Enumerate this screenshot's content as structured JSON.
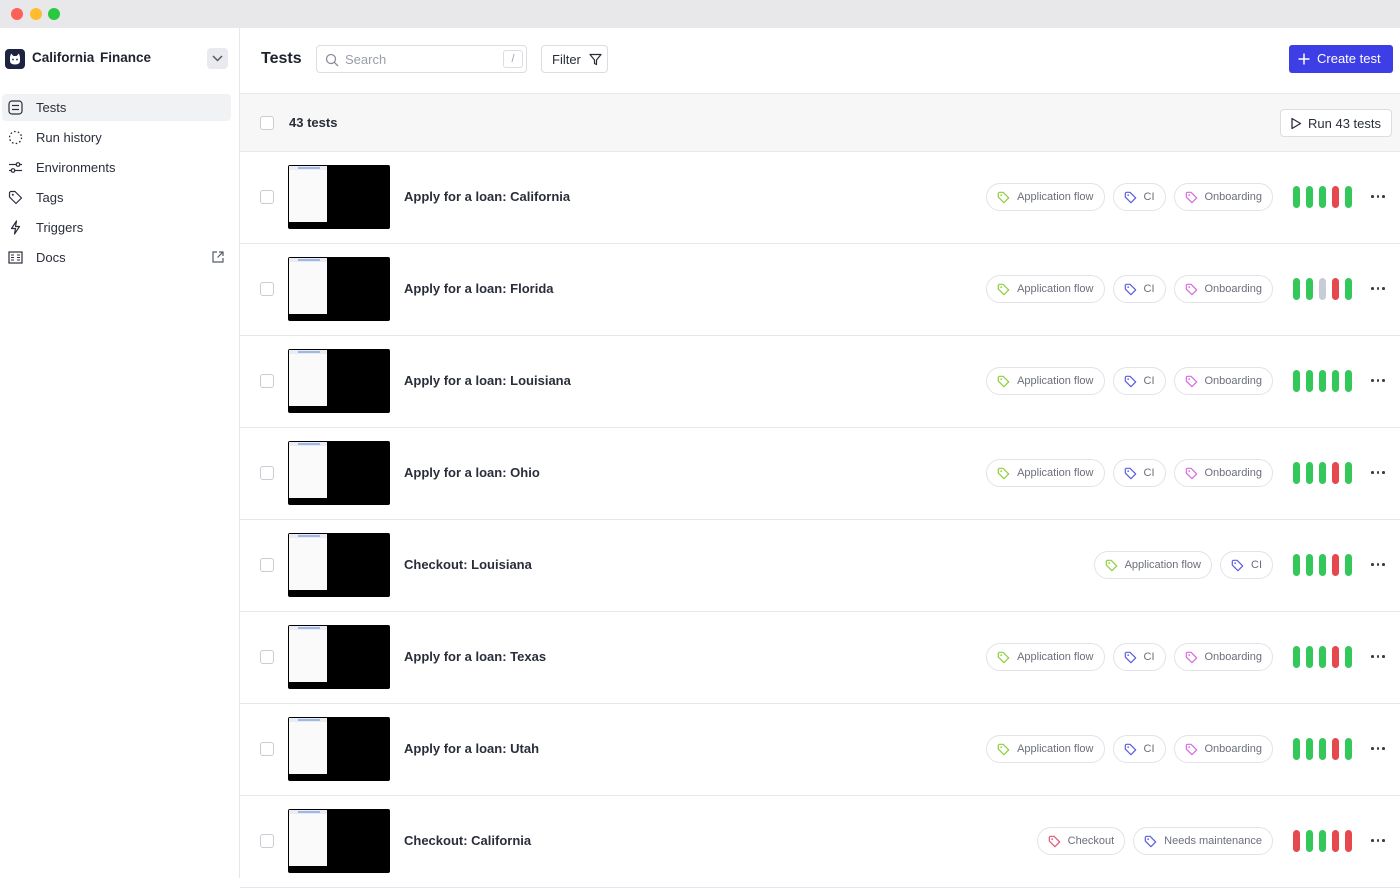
{
  "window": {},
  "sidebar": {
    "org_name": "California Finance",
    "items": [
      {
        "label": "Tests",
        "icon": "list-icon",
        "active": true
      },
      {
        "label": "Run history",
        "icon": "dashed-circle-icon",
        "active": false
      },
      {
        "label": "Environments",
        "icon": "sliders-icon",
        "active": false
      },
      {
        "label": "Tags",
        "icon": "tag-icon",
        "active": false
      },
      {
        "label": "Triggers",
        "icon": "lightning-icon",
        "active": false
      },
      {
        "label": "Docs",
        "icon": "book-icon",
        "active": false
      }
    ]
  },
  "header": {
    "title": "Tests",
    "search_placeholder": "Search",
    "search_shortcut": "/",
    "filter_label": "Filter",
    "create_label": "Create test"
  },
  "summary": {
    "count_label": "43 tests",
    "run_label": "Run 43 tests"
  },
  "colors": {
    "accent": "#3d3ee6",
    "pass": "#34c759",
    "fail": "#e5484d",
    "skipped": "#c8ccd6",
    "tag_application_flow": "#8fcf3c",
    "tag_ci": "#5b5fe0",
    "tag_onboarding": "#d86be0",
    "tag_checkout": "#e5567a",
    "tag_needs_maintenance": "#5b5fe0"
  },
  "tests": [
    {
      "name": "Apply for a loan: California",
      "tags": [
        {
          "label": "Application flow",
          "color": "#8fcf3c"
        },
        {
          "label": "CI",
          "color": "#5b5fe0"
        },
        {
          "label": "Onboarding",
          "color": "#d86be0"
        }
      ],
      "runs": [
        "pass",
        "pass",
        "pass",
        "fail",
        "pass"
      ]
    },
    {
      "name": "Apply for a loan: Florida",
      "tags": [
        {
          "label": "Application flow",
          "color": "#8fcf3c"
        },
        {
          "label": "CI",
          "color": "#5b5fe0"
        },
        {
          "label": "Onboarding",
          "color": "#d86be0"
        }
      ],
      "runs": [
        "pass",
        "pass",
        "skipped",
        "fail",
        "pass"
      ]
    },
    {
      "name": "Apply for a loan: Louisiana",
      "tags": [
        {
          "label": "Application flow",
          "color": "#8fcf3c"
        },
        {
          "label": "CI",
          "color": "#5b5fe0"
        },
        {
          "label": "Onboarding",
          "color": "#d86be0"
        }
      ],
      "runs": [
        "pass",
        "pass",
        "pass",
        "pass",
        "pass"
      ]
    },
    {
      "name": "Apply for a loan: Ohio",
      "tags": [
        {
          "label": "Application flow",
          "color": "#8fcf3c"
        },
        {
          "label": "CI",
          "color": "#5b5fe0"
        },
        {
          "label": "Onboarding",
          "color": "#d86be0"
        }
      ],
      "runs": [
        "pass",
        "pass",
        "pass",
        "fail",
        "pass"
      ]
    },
    {
      "name": "Checkout: Louisiana",
      "tags": [
        {
          "label": "Application flow",
          "color": "#8fcf3c"
        },
        {
          "label": "CI",
          "color": "#5b5fe0"
        }
      ],
      "runs": [
        "pass",
        "pass",
        "pass",
        "fail",
        "pass"
      ]
    },
    {
      "name": "Apply for a loan: Texas",
      "tags": [
        {
          "label": "Application flow",
          "color": "#8fcf3c"
        },
        {
          "label": "CI",
          "color": "#5b5fe0"
        },
        {
          "label": "Onboarding",
          "color": "#d86be0"
        }
      ],
      "runs": [
        "pass",
        "pass",
        "pass",
        "fail",
        "pass"
      ]
    },
    {
      "name": "Apply for a loan: Utah",
      "tags": [
        {
          "label": "Application flow",
          "color": "#8fcf3c"
        },
        {
          "label": "CI",
          "color": "#5b5fe0"
        },
        {
          "label": "Onboarding",
          "color": "#d86be0"
        }
      ],
      "runs": [
        "pass",
        "pass",
        "pass",
        "fail",
        "pass"
      ]
    },
    {
      "name": "Checkout: California",
      "tags": [
        {
          "label": "Checkout",
          "color": "#e5567a"
        },
        {
          "label": "Needs maintenance",
          "color": "#5b5fe0"
        }
      ],
      "runs": [
        "fail",
        "pass",
        "pass",
        "fail",
        "fail"
      ]
    }
  ]
}
